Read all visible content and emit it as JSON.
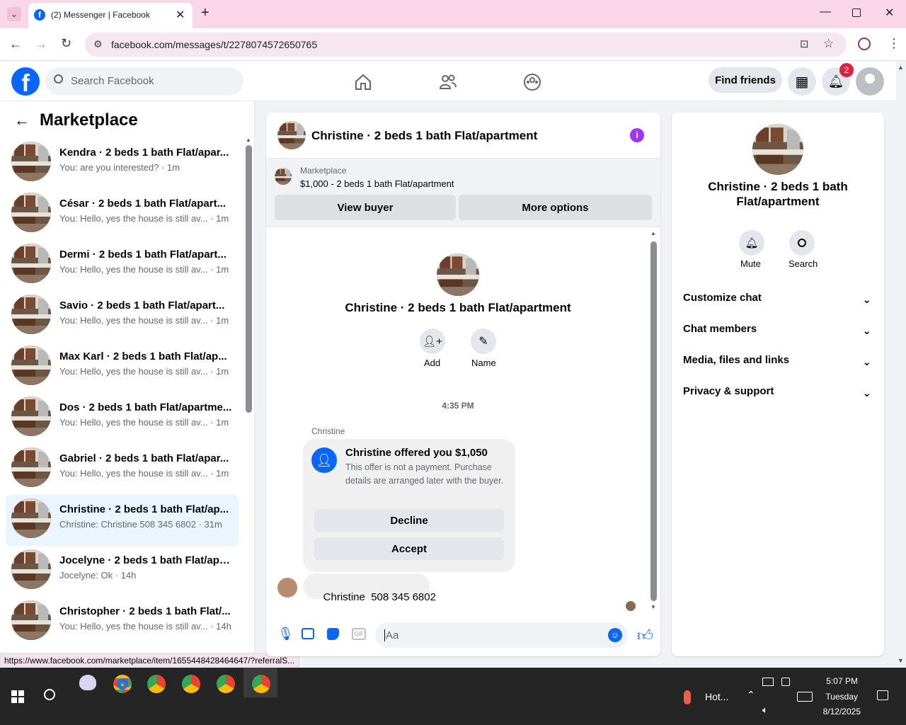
{
  "browser": {
    "tab_title": "(2) Messenger | Facebook",
    "url": "facebook.com/messages/t/2278074572650765",
    "status_url": "https://www.facebook.com/marketplace/item/1655448428464647/?referralS..."
  },
  "header": {
    "search_placeholder": "Search Facebook",
    "find_friends": "Find friends",
    "notifications_count": "2"
  },
  "sidebar": {
    "title": "Marketplace",
    "conversations": [
      {
        "title": "Kendra · 2 beds 1 bath Flat/apar...",
        "subtitle": "You: are you interested? · 1m",
        "active": false
      },
      {
        "title": "César · 2 beds 1 bath Flat/apart...",
        "subtitle": "You: Hello, yes the house is still av... · 1m",
        "active": false
      },
      {
        "title": "Dermi · 2 beds 1 bath Flat/apart...",
        "subtitle": "You: Hello, yes the house is still av... · 1m",
        "active": false
      },
      {
        "title": "Savio · 2 beds 1 bath Flat/apart...",
        "subtitle": "You: Hello, yes the house is still av... · 1m",
        "active": false
      },
      {
        "title": "Max Karl · 2 beds 1 bath Flat/ap...",
        "subtitle": "You: Hello, yes the house is still av... · 1m",
        "active": false
      },
      {
        "title": "Dos · 2 beds 1 bath Flat/apartme...",
        "subtitle": "You: Hello, yes the house is still av... · 1m",
        "active": false
      },
      {
        "title": "Gabriel · 2 beds 1 bath Flat/apar...",
        "subtitle": "You: Hello, yes the house is still av... · 1m",
        "active": false
      },
      {
        "title": "Christine · 2 beds 1 bath Flat/ap...",
        "subtitle": "Christine: Christine 508 345 6802 · 31m",
        "active": true
      },
      {
        "title": "Jocelyne · 2 beds 1 bath Flat/apa...",
        "subtitle": "Jocelyne: Ok · 14h",
        "active": false
      },
      {
        "title": "Christopher · 2 beds 1 bath Flat/...",
        "subtitle": "You: Hello, yes the house is still av... · 14h",
        "active": false
      }
    ]
  },
  "chat": {
    "title": "Christine · 2 beds 1 bath Flat/apartment",
    "listing_label": "Marketplace",
    "listing_detail": "$1,000 - 2 beds 1 bath Flat/apartment",
    "view_buyer": "View buyer",
    "more_options": "More options",
    "profile_name": "Christine · 2 beds 1 bath Flat/apartment",
    "add_label": "Add",
    "name_label": "Name",
    "timestamp": "4:35 PM",
    "sender_name": "Christine",
    "offer_title": "Christine offered you $1,050",
    "offer_body": "This offer is not a payment. Purchase details are arranged later with the buyer.",
    "decline": "Decline",
    "accept": "Accept",
    "message_text": "Christine  508 345 6802",
    "composer_placeholder": "Aa"
  },
  "details": {
    "name": "Christine · 2 beds 1 bath Flat/apartment",
    "mute": "Mute",
    "search": "Search",
    "sections": [
      "Customize chat",
      "Chat members",
      "Media, files and links",
      "Privacy & support"
    ]
  },
  "taskbar": {
    "weather": "Hot...",
    "time": "5:07 PM",
    "day": "Tuesday",
    "date": "8/12/2025"
  },
  "colors": {
    "fb_blue": "#0866ff",
    "active_conv": "#ebf5ff",
    "tab_bar": "#f9d6e8",
    "info_purple": "#a033ff",
    "badge_red": "#e41e3f"
  }
}
